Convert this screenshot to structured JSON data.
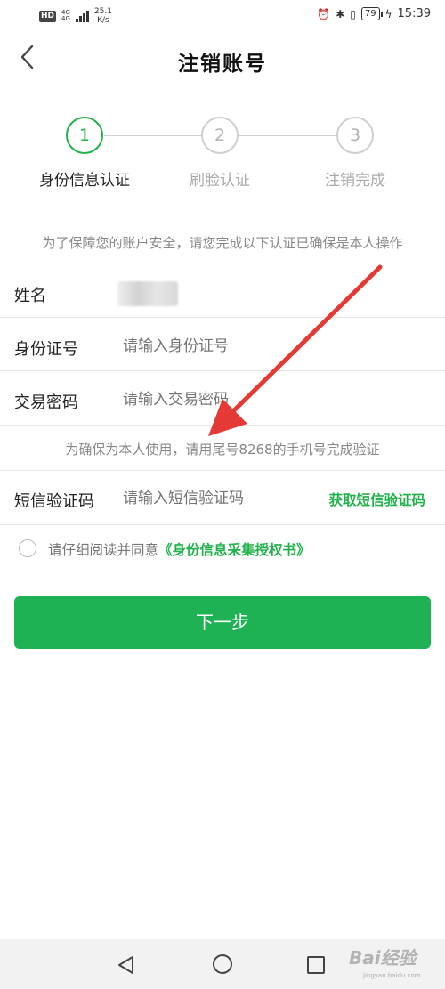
{
  "status_bar": {
    "hd": "HD",
    "network": "4G",
    "network_sub": "4G",
    "speed_value": "25.1",
    "speed_unit": "K/s",
    "battery": "79",
    "time": "15:39"
  },
  "header": {
    "title": "注销账号"
  },
  "stepper": {
    "steps": [
      {
        "number": "1",
        "label": "身份信息认证",
        "active": true
      },
      {
        "number": "2",
        "label": "刷脸认证",
        "active": false
      },
      {
        "number": "3",
        "label": "注销完成",
        "active": false
      }
    ]
  },
  "notice": "为了保障您的账户安全，请您完成以下认证已确保是本人操作",
  "form": {
    "name_label": "姓名",
    "id_label": "身份证号",
    "id_placeholder": "请输入身份证号",
    "password_label": "交易密码",
    "password_placeholder": "请输入交易密码",
    "verify_note": "为确保为本人使用，请用尾号8268的手机号完成验证",
    "sms_label": "短信验证码",
    "sms_placeholder": "请输入短信验证码",
    "sms_link": "获取短信验证码"
  },
  "agreement": {
    "prefix": "请仔细阅读并同意",
    "link": "《身份信息采集授权书》"
  },
  "next_button": "下一步",
  "colors": {
    "accent": "#1fb255",
    "arrow": "#e53935"
  },
  "watermark": {
    "text": "Bai经验",
    "sub": "jingyan.baidu.com"
  }
}
